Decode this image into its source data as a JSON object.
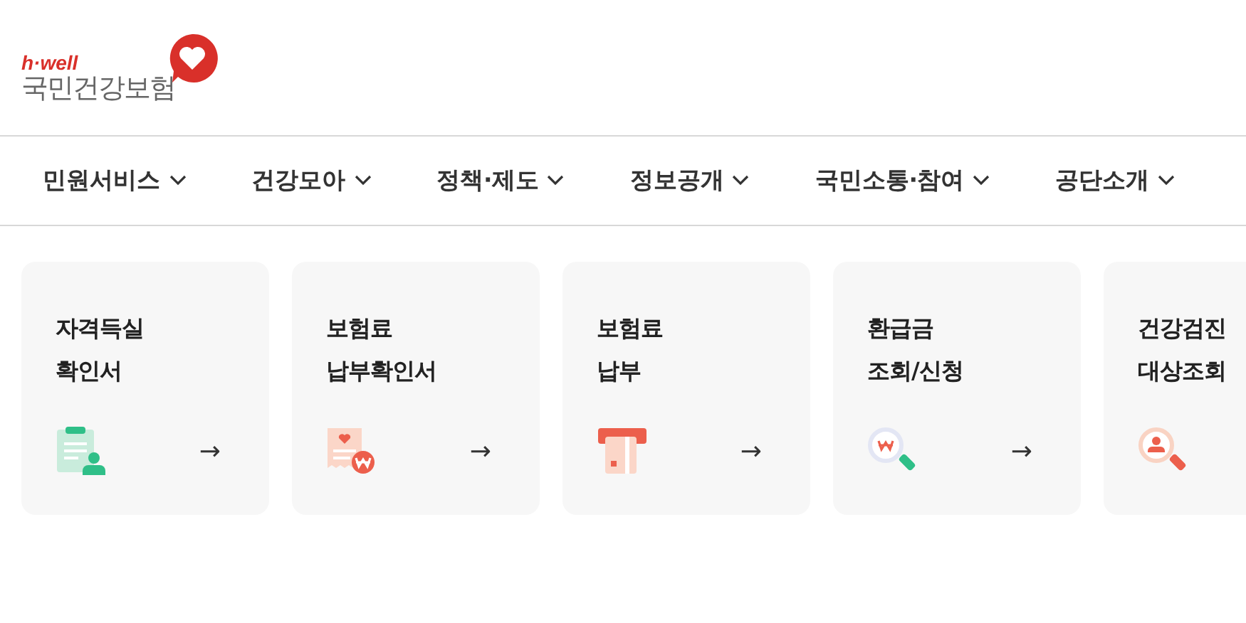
{
  "logo": {
    "tagline": "h·well",
    "name": "국민건강보험"
  },
  "nav": [
    {
      "label": "민원서비스"
    },
    {
      "label": "건강모아"
    },
    {
      "label": "정책·제도"
    },
    {
      "label": "정보공개"
    },
    {
      "label": "국민소통·참여"
    },
    {
      "label": "공단소개"
    }
  ],
  "cards": [
    {
      "lines": [
        "자격득실",
        "확인서"
      ],
      "kind": "clipboard",
      "arrow": "→"
    },
    {
      "lines": [
        "보험료",
        "납부확인서"
      ],
      "kind": "receipt",
      "arrow": "→"
    },
    {
      "lines": [
        "보험료",
        "납부"
      ],
      "kind": "card",
      "arrow": "→"
    },
    {
      "lines": [
        "환급금",
        "조회/신청"
      ],
      "kind": "search-won",
      "arrow": "→"
    },
    {
      "lines": [
        "건강검진",
        "대상조회"
      ],
      "kind": "search-person"
    }
  ]
}
